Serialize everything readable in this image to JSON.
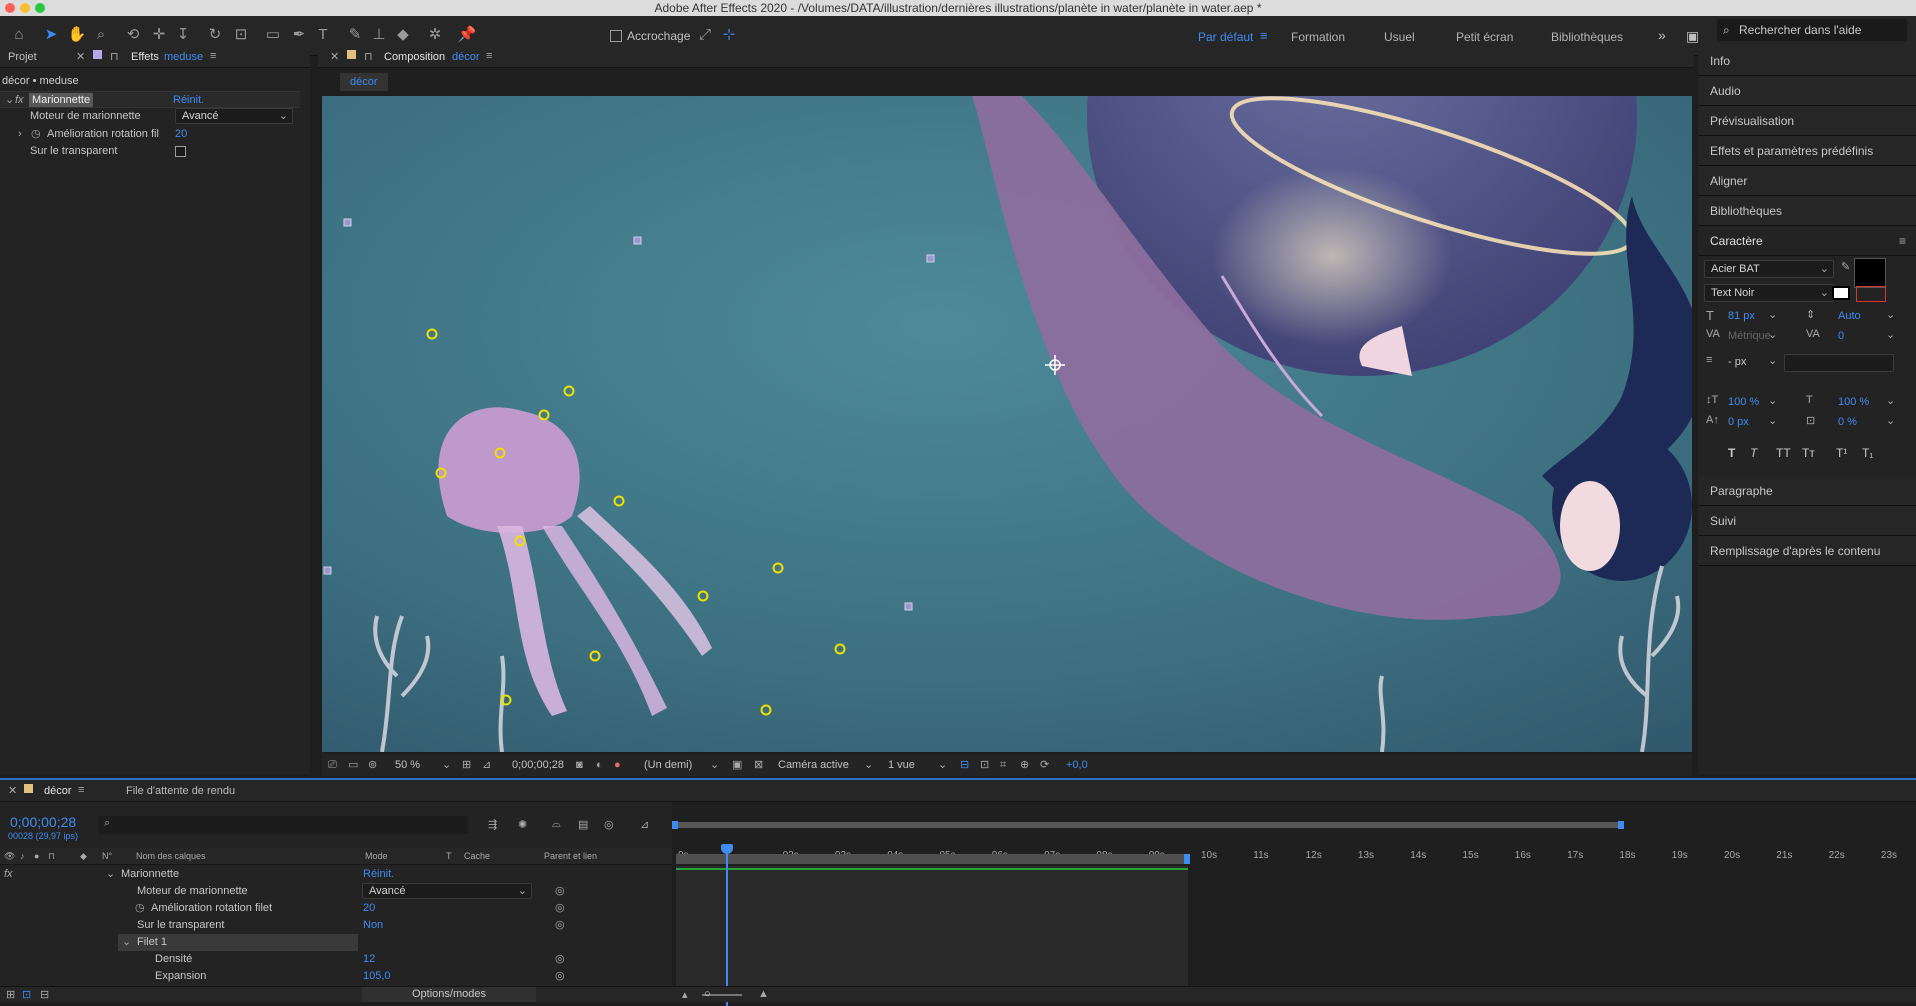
{
  "window": {
    "title": "Adobe After Effects 2020 - /Volumes/DATA/illustration/dernières illustrations/planète in water/planète in water.aep *"
  },
  "toolbar": {
    "snapping_label": "Accrochage",
    "workspaces": [
      "Par défaut",
      "Formation",
      "Usuel",
      "Petit écran",
      "Bibliothèques"
    ],
    "active_workspace": "Par défaut",
    "search_placeholder": "Rechercher dans l'aide"
  },
  "effects_panel": {
    "tabs": [
      "Projet",
      "Effets"
    ],
    "layer_name": "meduse",
    "header_title": "décor • meduse",
    "effect_name": "Marionnette",
    "reset_label": "Réinit.",
    "params": [
      {
        "label": "Moteur de marionnette",
        "value": "Avancé"
      },
      {
        "label": "Amélioration rotation fil",
        "value": "20"
      },
      {
        "label": "Sur le transparent",
        "value": ""
      }
    ]
  },
  "composition": {
    "tab_label": "Composition",
    "comp_name": "décor",
    "breadcrumb": "décor"
  },
  "viewer_bar": {
    "zoom": "50 %",
    "timecode": "0;00;00;28",
    "resolution": "(Un demi)",
    "camera": "Caméra active",
    "views": "1 vue",
    "exposure": "+0,0"
  },
  "right_panel": {
    "sections_top": [
      "Info",
      "Audio",
      "Prévisualisation",
      "Effets et paramètres prédéfinis",
      "Aligner",
      "Bibliothèques"
    ],
    "caractere": {
      "title": "Caractère",
      "font_family": "Acier BAT",
      "font_style": "Text Noir",
      "font_size": "81 px",
      "leading": "Auto",
      "kerning": "Métrique",
      "tracking": "0",
      "stroke": "- px",
      "vscale": "100 %",
      "hscale": "100 %",
      "baseline": "0 px",
      "tsume": "0 %",
      "styles": [
        "T",
        "T",
        "TT",
        "Tт",
        "T¹",
        "T₁"
      ]
    },
    "sections_bottom": [
      "Paragraphe",
      "Suivi",
      "Remplissage d'après le contenu"
    ]
  },
  "timeline": {
    "tabs": [
      "décor",
      "File d'attente de rendu"
    ],
    "timecode": "0;00;00;28",
    "frame_info": "00028 (29,97 ips)",
    "column_headers": [
      "N°",
      "Nom des calques",
      "Mode",
      "T",
      "Cache",
      "Parent et lien"
    ],
    "rows": [
      {
        "label": "Marionnette",
        "value": "Réinit."
      },
      {
        "label": "Moteur de marionnette",
        "value": "Avancé"
      },
      {
        "label": "Amélioration rotation filet",
        "value": "20"
      },
      {
        "label": "Sur le transparent",
        "value": "Non"
      },
      {
        "label": "Filet 1",
        "value": ""
      },
      {
        "label": "Densité",
        "value": "12"
      },
      {
        "label": "Expansion",
        "value": "105,0"
      }
    ],
    "ruler": [
      "0s",
      "02s",
      "03s",
      "04s",
      "05s",
      "06s",
      "07s",
      "08s",
      "09s",
      "10s",
      "11s",
      "12s",
      "13s",
      "14s",
      "15s",
      "16s",
      "17s",
      "18s",
      "19s",
      "20s",
      "21s",
      "22s",
      "23s"
    ],
    "footer_label": "Options/modes"
  }
}
